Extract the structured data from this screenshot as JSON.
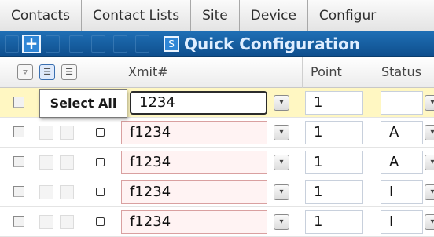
{
  "tabs": [
    "Contacts",
    "Contact Lists",
    "Site",
    "Device",
    "Configur"
  ],
  "toolbar": {
    "new_symbol": "+",
    "refresh_symbol": "S",
    "title": "Quick Configuration"
  },
  "columns": {
    "xmit": "Xmit#",
    "point": "Point",
    "status": "Status"
  },
  "tooltip": "Select All",
  "rows": [
    {
      "xmit": "1234",
      "point": "1",
      "status": ""
    },
    {
      "xmit": "f1234",
      "point": "1",
      "status": "A"
    },
    {
      "xmit": "f1234",
      "point": "1",
      "status": "A"
    },
    {
      "xmit": "f1234",
      "point": "1",
      "status": "I"
    },
    {
      "xmit": "f1234",
      "point": "1",
      "status": "I"
    }
  ],
  "dropdown_glyph": "▾",
  "colors": {
    "toolbar": "#1563a8",
    "active_row": "#fff7c2",
    "field_invalid": "#fff3f3"
  }
}
